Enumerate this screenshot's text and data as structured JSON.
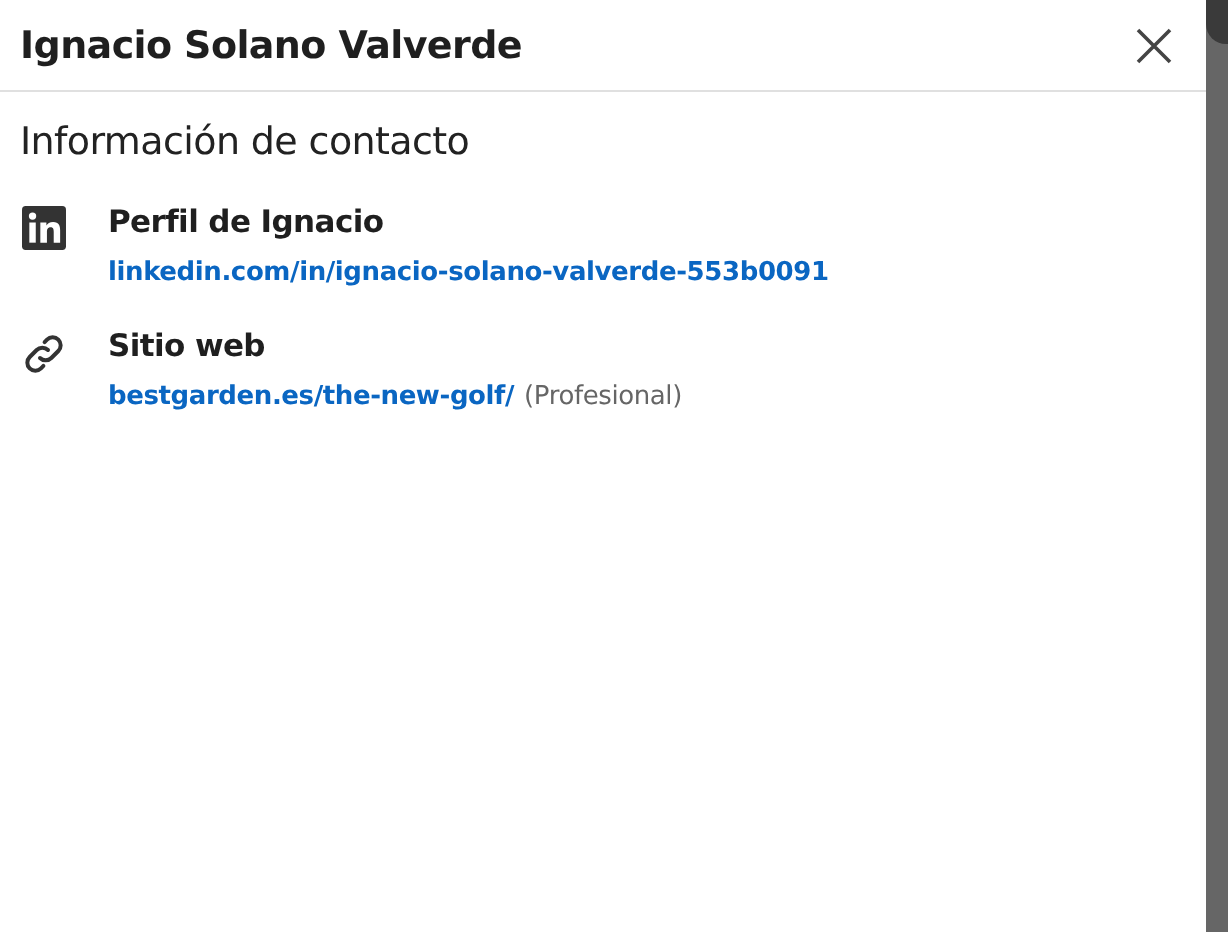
{
  "dialog": {
    "title": "Ignacio Solano Valverde"
  },
  "section": {
    "title": "Información de contacto",
    "items": [
      {
        "kind": "profile",
        "label": "Perfil de Ignacio",
        "link": "linkedin.com/in/ignacio-solano-valverde-553b0091"
      },
      {
        "kind": "website",
        "label": "Sitio web",
        "link": "bestgarden.es/the-new-golf/",
        "note": "(Profesional)"
      }
    ]
  }
}
